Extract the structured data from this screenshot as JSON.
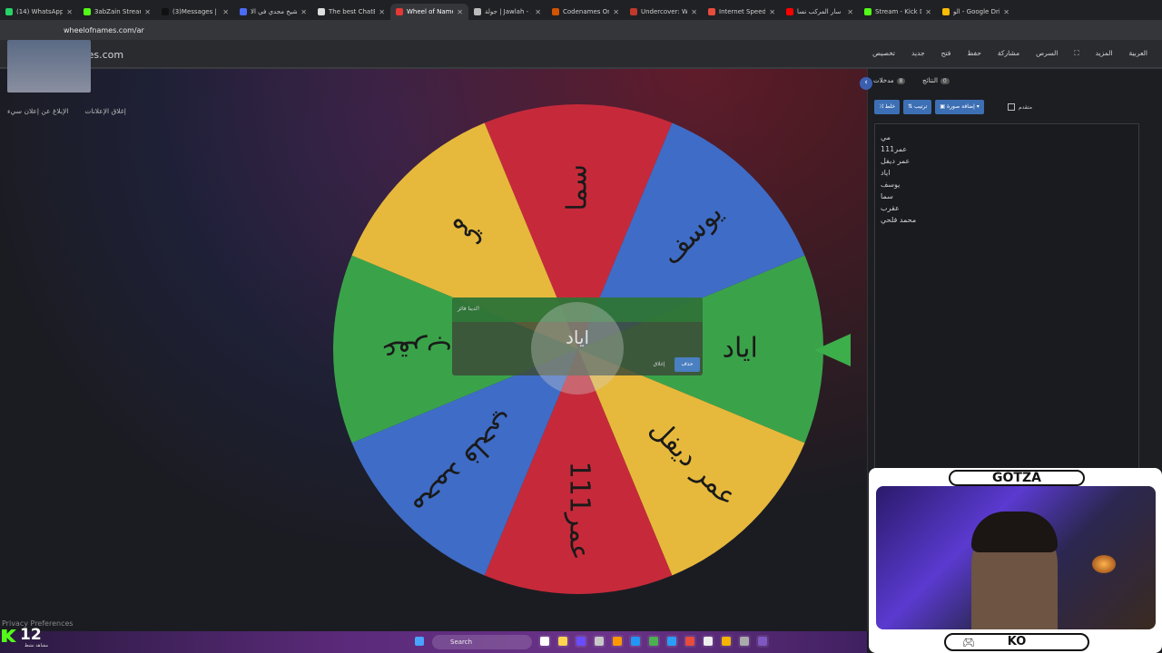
{
  "browser": {
    "tabs": [
      {
        "label": "(14) WhatsApp",
        "color": "#25d366"
      },
      {
        "label": "3abZain Stream - K",
        "color": "#53fc18"
      },
      {
        "label": "(3)Messages | TikT",
        "color": "#111111"
      },
      {
        "label": "الشيخ مجدي في الا",
        "color": "#4a6cf7"
      },
      {
        "label": "The best ChatBot o",
        "color": "#dddddd"
      },
      {
        "label": "Wheel of Names |",
        "color": "#e53935",
        "active": true
      },
      {
        "label": "جولة | Jawlah - مزيد",
        "color": "#bbbbbb"
      },
      {
        "label": "Codenames Online",
        "color": "#d35400"
      },
      {
        "label": "Undercover: Word",
        "color": "#c0392b"
      },
      {
        "label": "Internet Speed Tes",
        "color": "#e74c3c"
      },
      {
        "label": "لما سار المركب نسا",
        "color": "#ff0000"
      },
      {
        "label": "Stream - Kick Dash",
        "color": "#53fc18"
      },
      {
        "label": "الو - Google Drive",
        "color": "#fbbc04"
      }
    ],
    "url": "wheelofnames.com/ar"
  },
  "app": {
    "logo_text": "wheelofnames.com",
    "menu": [
      "العربية",
      "المزيد",
      "",
      "السرص",
      "مشاركة",
      "حفظ",
      "فتح",
      "جديد",
      "تخصيص"
    ],
    "ad_links": [
      "إغلاق الإعلانات",
      "الإبلاغ عن إعلان سيء"
    ]
  },
  "wheel": {
    "segments": [
      {
        "label": "سما",
        "color": "#c62a3a"
      },
      {
        "label": "يوسف",
        "color": "#3f6cc6"
      },
      {
        "label": "اياد",
        "color": "#3aa34a"
      },
      {
        "label": "عمر ديفل",
        "color": "#e6b93c"
      },
      {
        "label": "عمر111",
        "color": "#c62a3a"
      },
      {
        "label": "محمد فلحي",
        "color": "#3f6cc6"
      },
      {
        "label": "عقرب",
        "color": "#3aa34a"
      },
      {
        "label": "مي",
        "color": "#e6b93c"
      }
    ]
  },
  "winner": {
    "header": "لدينا فائز!",
    "name": "اياد",
    "remove_label": "حذف",
    "close_label": "إغلاق"
  },
  "panel": {
    "tabs": [
      {
        "label": "مدخلات",
        "count": "8"
      },
      {
        "label": "النتائج",
        "count": "0"
      }
    ],
    "toolbar": {
      "shuffle": "خلط",
      "sort": "ترتيب",
      "add_image": "إضافة صورة",
      "advanced": "متقدم"
    },
    "entries": [
      "مي",
      "عمر111",
      "عمر ديفل",
      "اياد",
      "يوسف",
      "سما",
      "عقرب",
      "محمد فلحي"
    ]
  },
  "stream": {
    "title": "GOTZA",
    "footer": "KO",
    "viewer_count": "12",
    "viewer_label": "مشاهد نشط"
  },
  "taskbar": {
    "search": "Search",
    "privacy": "Privacy Preferences"
  }
}
